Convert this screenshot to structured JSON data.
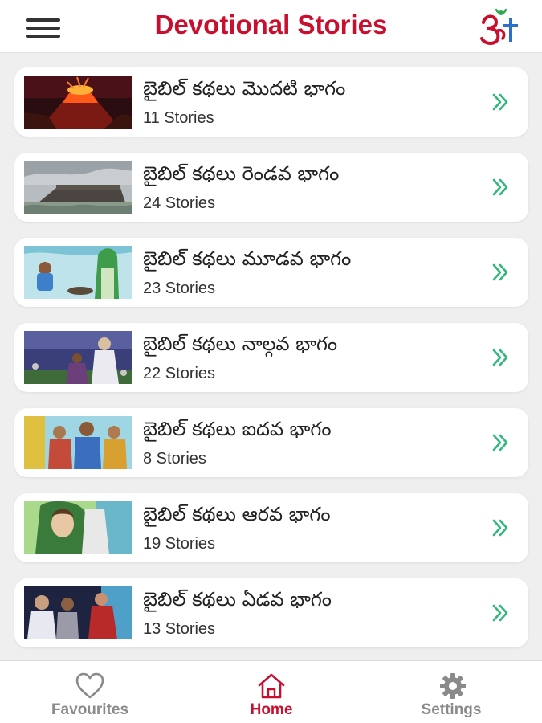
{
  "header": {
    "title": "Devotional Stories",
    "menu_icon": "hamburger-menu-icon",
    "logo_icon": "om-cross-logo-icon"
  },
  "colors": {
    "accent": "#c8102e",
    "chevron": "#2fb87a",
    "tab_inactive": "#8a8a8a"
  },
  "stories": [
    {
      "title": "బైబిల్ కథలు మొదటి భాగం",
      "count": "11 Stories",
      "thumb": "volcano-illustration"
    },
    {
      "title": "బైబిల్ కథలు రెండవ భాగం",
      "count": "24 Stories",
      "thumb": "ark-illustration"
    },
    {
      "title": "బైబిల్ కథలు మూడవ భాగం",
      "count": "23 Stories",
      "thumb": "well-illustration"
    },
    {
      "title": "బైబిల్ కథలు నాల్గవ భాగం",
      "count": "22 Stories",
      "thumb": "prophet-illustration"
    },
    {
      "title": "బైబిల్ కథలు ఐదవ భాగం",
      "count": "8 Stories",
      "thumb": "men-illustration"
    },
    {
      "title": "బైబిల్ కథలు ఆరవ భాగం",
      "count": "19 Stories",
      "thumb": "woman-illustration"
    },
    {
      "title": "బైబిల్ కథలు ఏడవ భాగం",
      "count": "13 Stories",
      "thumb": "apostles-illustration"
    }
  ],
  "tabs": [
    {
      "label": "Favourites",
      "icon": "heart-icon",
      "active": false
    },
    {
      "label": "Home",
      "icon": "home-icon",
      "active": true
    },
    {
      "label": "Settings",
      "icon": "gear-icon",
      "active": false
    }
  ]
}
